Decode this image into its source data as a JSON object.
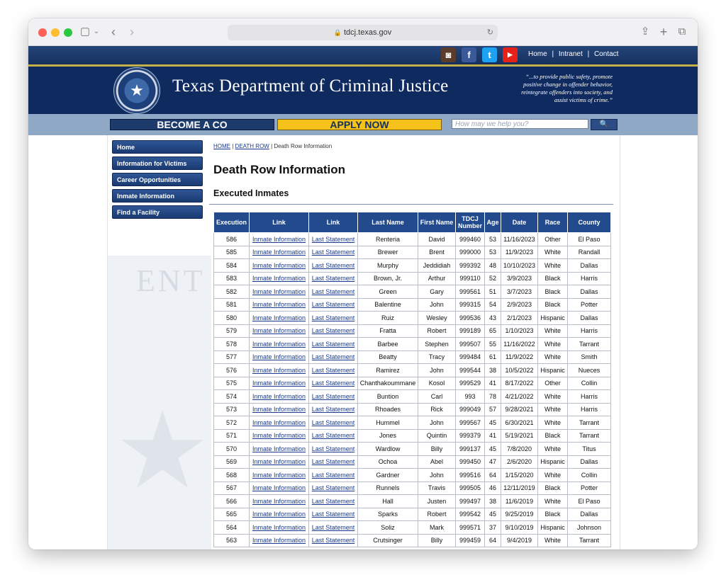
{
  "browser": {
    "url": "tdcj.texas.gov"
  },
  "top_links": {
    "home": "Home",
    "intranet": "Intranet",
    "contact": "Contact",
    "sep": "|"
  },
  "header": {
    "title": "Texas Department of Criminal Justice",
    "motto_lines": [
      "“...to provide public safety, promote",
      "positive change in offender behavior,",
      "reintegrate offenders into society, and",
      "assist victims of crime.”"
    ]
  },
  "banner_nav": {
    "become_co": "BECOME A CO",
    "apply_now": "APPLY NOW",
    "search_placeholder": "How may we help you?"
  },
  "sidebar": {
    "items": [
      {
        "label": "Home"
      },
      {
        "label": "Information for Victims"
      },
      {
        "label": "Career Opportunities"
      },
      {
        "label": "Inmate Information"
      },
      {
        "label": "Find a Facility"
      }
    ]
  },
  "breadcrumb": {
    "home": "HOME",
    "death_row": "DEATH ROW",
    "sep": "|",
    "current": "Death Row Information"
  },
  "main": {
    "title": "Death Row Information",
    "subtitle": "Executed Inmates"
  },
  "table": {
    "headers": [
      "Execution",
      "Link",
      "Link",
      "Last Name",
      "First Name",
      "TDCJ Number",
      "Age",
      "Date",
      "Race",
      "County"
    ],
    "link_labels": {
      "inmate": "Inmate Information",
      "statement": "Last Statement"
    },
    "rows": [
      [
        "586",
        "Renteria",
        "David",
        "999460",
        "53",
        "11/16/2023",
        "Other",
        "El Paso"
      ],
      [
        "585",
        "Brewer",
        "Brent",
        "999000",
        "53",
        "11/9/2023",
        "White",
        "Randall"
      ],
      [
        "584",
        "Murphy",
        "Jeddidiah",
        "999392",
        "48",
        "10/10/2023",
        "White",
        "Dallas"
      ],
      [
        "583",
        "Brown, Jr.",
        "Arthur",
        "999110",
        "52",
        "3/9/2023",
        "Black",
        "Harris"
      ],
      [
        "582",
        "Green",
        "Gary",
        "999561",
        "51",
        "3/7/2023",
        "Black",
        "Dallas"
      ],
      [
        "581",
        "Balentine",
        "John",
        "999315",
        "54",
        "2/9/2023",
        "Black",
        "Potter"
      ],
      [
        "580",
        "Ruiz",
        "Wesley",
        "999536",
        "43",
        "2/1/2023",
        "Hispanic",
        "Dallas"
      ],
      [
        "579",
        "Fratta",
        "Robert",
        "999189",
        "65",
        "1/10/2023",
        "White",
        "Harris"
      ],
      [
        "578",
        "Barbee",
        "Stephen",
        "999507",
        "55",
        "11/16/2022",
        "White",
        "Tarrant"
      ],
      [
        "577",
        "Beatty",
        "Tracy",
        "999484",
        "61",
        "11/9/2022",
        "White",
        "Smith"
      ],
      [
        "576",
        "Ramirez",
        "John",
        "999544",
        "38",
        "10/5/2022",
        "Hispanic",
        "Nueces"
      ],
      [
        "575",
        "Chanthakoummane",
        "Kosol",
        "999529",
        "41",
        "8/17/2022",
        "Other",
        "Collin"
      ],
      [
        "574",
        "Buntion",
        "Carl",
        "993",
        "78",
        "4/21/2022",
        "White",
        "Harris"
      ],
      [
        "573",
        "Rhoades",
        "Rick",
        "999049",
        "57",
        "9/28/2021",
        "White",
        "Harris"
      ],
      [
        "572",
        "Hummel",
        "John",
        "999567",
        "45",
        "6/30/2021",
        "White",
        "Tarrant"
      ],
      [
        "571",
        "Jones",
        "Quintin",
        "999379",
        "41",
        "5/19/2021",
        "Black",
        "Tarrant"
      ],
      [
        "570",
        "Wardlow",
        "Billy",
        "999137",
        "45",
        "7/8/2020",
        "White",
        "Titus"
      ],
      [
        "569",
        "Ochoa",
        "Abel",
        "999450",
        "47",
        "2/6/2020",
        "Hispanic",
        "Dallas"
      ],
      [
        "568",
        "Gardner",
        "John",
        "999516",
        "64",
        "1/15/2020",
        "White",
        "Collin"
      ],
      [
        "567",
        "Runnels",
        "Travis",
        "999505",
        "46",
        "12/11/2019",
        "Black",
        "Potter"
      ],
      [
        "566",
        "Hall",
        "Justen",
        "999497",
        "38",
        "11/6/2019",
        "White",
        "El Paso"
      ],
      [
        "565",
        "Sparks",
        "Robert",
        "999542",
        "45",
        "9/25/2019",
        "Black",
        "Dallas"
      ],
      [
        "564",
        "Soliz",
        "Mark",
        "999571",
        "37",
        "9/10/2019",
        "Hispanic",
        "Johnson"
      ],
      [
        "563",
        "Crutsinger",
        "Billy",
        "999459",
        "64",
        "9/4/2019",
        "White",
        "Tarrant"
      ]
    ]
  },
  "icons": {
    "social": [
      "instagram-icon",
      "facebook-icon",
      "twitter-icon",
      "youtube-icon"
    ]
  },
  "colors": {
    "header_navy": "#0f2a5e",
    "table_header": "#224a8c",
    "apply_yellow": "#f4c21b"
  }
}
